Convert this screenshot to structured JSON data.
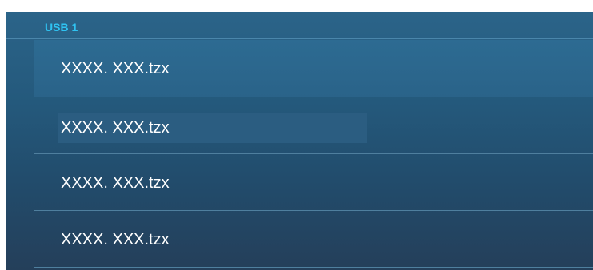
{
  "header": {
    "title": "USB 1"
  },
  "files": [
    {
      "name": "XXXX. XXX.tzx"
    },
    {
      "name": "XXXX. XXX.tzx"
    },
    {
      "name": "XXXX. XXX.tzx"
    },
    {
      "name": "XXXX. XXX.tzx"
    }
  ],
  "colors": {
    "header_text": "#2fc3f2",
    "panel_top": "#2b6489",
    "panel_bottom": "#243f5a",
    "file_text": "#ffffff"
  }
}
